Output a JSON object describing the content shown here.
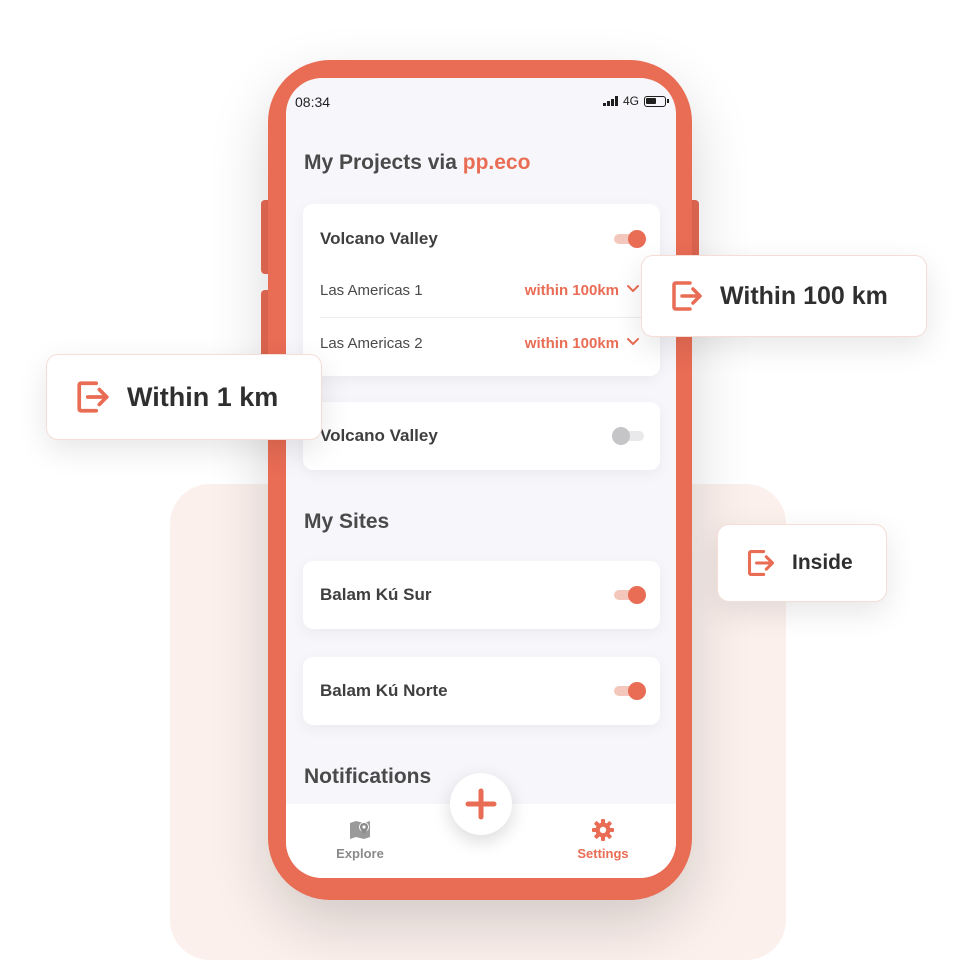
{
  "colors": {
    "accent": "#e96c54",
    "screen_bg": "#f7f7fb",
    "panel_bg": "#fbeeea"
  },
  "status_bar": {
    "time": "08:34",
    "network": "4G"
  },
  "projects": {
    "title_prefix": "My Projects via",
    "title_link": "pp.eco",
    "cards": [
      {
        "name": "Volcano Valley",
        "enabled": true,
        "rows": [
          {
            "name": "Las Americas 1",
            "value": "within 100km"
          },
          {
            "name": "Las Americas 2",
            "value": "within 100km"
          }
        ]
      },
      {
        "name": "Volcano Valley",
        "enabled": false
      }
    ]
  },
  "sites": {
    "title": "My Sites",
    "cards": [
      {
        "name": "Balam Kú Sur",
        "enabled": true
      },
      {
        "name": "Balam Kú Norte",
        "enabled": true
      }
    ]
  },
  "notifications": {
    "title": "Notifications"
  },
  "tabbar": {
    "explore": {
      "label": "Explore",
      "icon": "map-pin-icon"
    },
    "settings": {
      "label": "Settings",
      "icon": "gear-icon"
    },
    "fab": {
      "icon": "plus-icon"
    }
  },
  "callouts": {
    "within_100": {
      "label": "Within 100 km",
      "icon": "enter-icon"
    },
    "within_1": {
      "label": "Within 1 km",
      "icon": "enter-icon"
    },
    "inside": {
      "label": "Inside",
      "icon": "enter-icon"
    }
  }
}
